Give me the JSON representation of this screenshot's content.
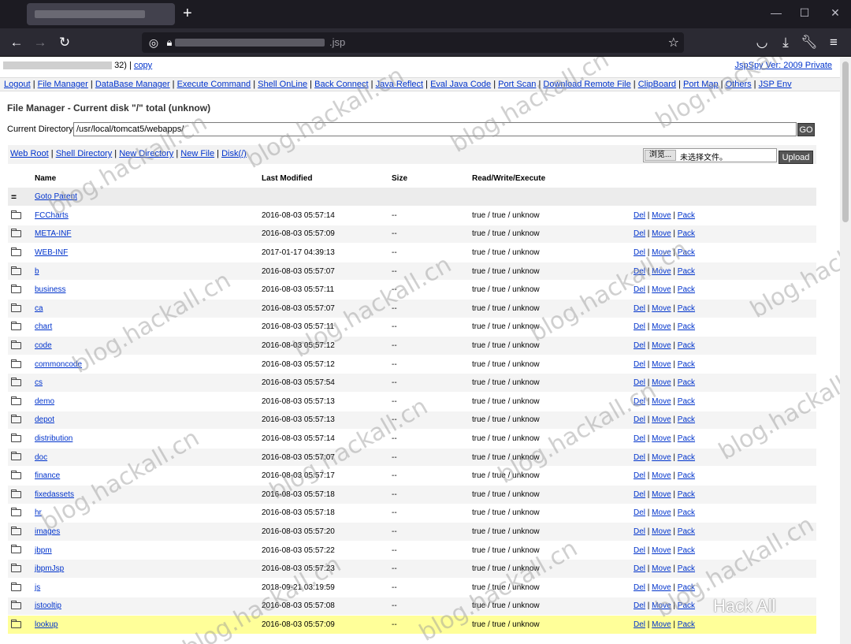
{
  "browser": {
    "url_suffix": ".jsp",
    "new_tab": "+",
    "min": "—",
    "max": "☐",
    "close": "✕"
  },
  "header": {
    "ip_suffix": "32) |",
    "copy_label": "copy",
    "version": "JspSpy Ver: 2009 Private"
  },
  "menu": [
    "Logout",
    "File Manager",
    "DataBase Manager",
    "Execute Command",
    "Shell OnLine",
    "Back Connect",
    "Java Reflect",
    "Eval Java Code",
    "Port Scan",
    "Download Remote File",
    "ClipBoard",
    "Port Map",
    "Others",
    "JSP Env"
  ],
  "file_manager": {
    "title": "File Manager - Current disk \"/\" total (unknow)",
    "current_dir_label": "Current Directory",
    "current_dir_value": "/usr/local/tomcat5/webapps/",
    "go_label": "GO",
    "tools": [
      "Web Root",
      "Shell Directory",
      "New Directory",
      "New File",
      "Disk(/)"
    ],
    "browse_label": "浏览...",
    "no_file_label": "未选择文件。",
    "upload_label": "Upload"
  },
  "table": {
    "headers": [
      "Name",
      "Last Modified",
      "Size",
      "Read/Write/Execute"
    ],
    "parent_label": "Goto Parent",
    "parent_symbol": "=",
    "action_del": "Del",
    "action_move": "Move",
    "action_pack": "Pack",
    "rows": [
      {
        "name": "FCCharts",
        "modified": "2016-08-03 05:57:14",
        "size": "--",
        "rwx": "true / true / unknow"
      },
      {
        "name": "META-INF",
        "modified": "2016-08-03 05:57:09",
        "size": "--",
        "rwx": "true / true / unknow"
      },
      {
        "name": "WEB-INF",
        "modified": "2017-01-17 04:39:13",
        "size": "--",
        "rwx": "true / true / unknow"
      },
      {
        "name": "b",
        "modified": "2016-08-03 05:57:07",
        "size": "--",
        "rwx": "true / true / unknow"
      },
      {
        "name": "business",
        "modified": "2016-08-03 05:57:11",
        "size": "--",
        "rwx": "true / true / unknow"
      },
      {
        "name": "ca",
        "modified": "2016-08-03 05:57:07",
        "size": "--",
        "rwx": "true / true / unknow"
      },
      {
        "name": "chart",
        "modified": "2016-08-03 05:57:11",
        "size": "--",
        "rwx": "true / true / unknow"
      },
      {
        "name": "code",
        "modified": "2016-08-03 05:57:12",
        "size": "--",
        "rwx": "true / true / unknow"
      },
      {
        "name": "commoncode",
        "modified": "2016-08-03 05:57:12",
        "size": "--",
        "rwx": "true / true / unknow"
      },
      {
        "name": "cs",
        "modified": "2016-08-03 05:57:54",
        "size": "--",
        "rwx": "true / true / unknow"
      },
      {
        "name": "demo",
        "modified": "2016-08-03 05:57:13",
        "size": "--",
        "rwx": "true / true / unknow"
      },
      {
        "name": "depot",
        "modified": "2016-08-03 05:57:13",
        "size": "--",
        "rwx": "true / true / unknow"
      },
      {
        "name": "distribution",
        "modified": "2016-08-03 05:57:14",
        "size": "--",
        "rwx": "true / true / unknow"
      },
      {
        "name": "doc",
        "modified": "2016-08-03 05:57:07",
        "size": "--",
        "rwx": "true / true / unknow"
      },
      {
        "name": "finance",
        "modified": "2016-08-03 05:57:17",
        "size": "--",
        "rwx": "true / true / unknow"
      },
      {
        "name": "fixedassets",
        "modified": "2016-08-03 05:57:18",
        "size": "--",
        "rwx": "true / true / unknow"
      },
      {
        "name": "hr",
        "modified": "2016-08-03 05:57:18",
        "size": "--",
        "rwx": "true / true / unknow"
      },
      {
        "name": "images",
        "modified": "2016-08-03 05:57:20",
        "size": "--",
        "rwx": "true / true / unknow"
      },
      {
        "name": "jbpm",
        "modified": "2016-08-03 05:57:22",
        "size": "--",
        "rwx": "true / true / unknow"
      },
      {
        "name": "jbpmJsp",
        "modified": "2016-08-03 05:57:23",
        "size": "--",
        "rwx": "true / true / unknow"
      },
      {
        "name": "js",
        "modified": "2018-09-21 03:19:59",
        "size": "--",
        "rwx": "true / true / unknow"
      },
      {
        "name": "jstooltip",
        "modified": "2016-08-03 05:57:08",
        "size": "--",
        "rwx": "true / true / unknow"
      },
      {
        "name": "lookup",
        "modified": "2016-08-03 05:57:09",
        "size": "--",
        "rwx": "true / true / unknow",
        "highlight": true
      }
    ]
  },
  "watermark": "blog.hackall.cn",
  "brand": "Hack All"
}
